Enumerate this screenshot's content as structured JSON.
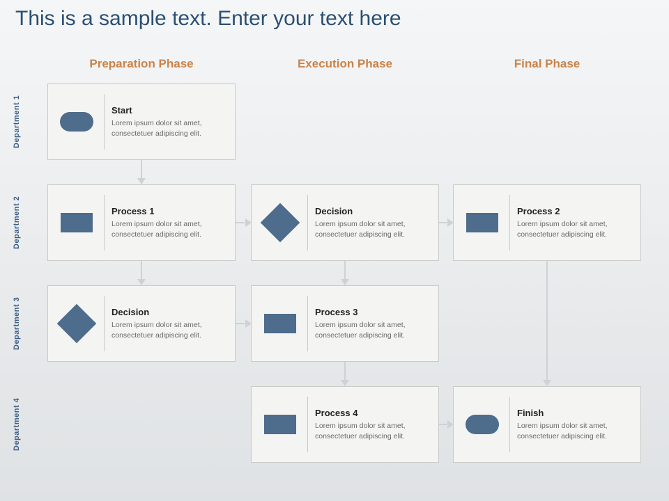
{
  "title": "This is a sample text. Enter your text here",
  "phases": {
    "p1": "Preparation Phase",
    "p2": "Execution Phase",
    "p3": "Final Phase"
  },
  "departments": {
    "d1": "Department 1",
    "d2": "Department 2",
    "d3": "Department 3",
    "d4": "Department 4"
  },
  "lorem": "Lorem ipsum dolor sit amet, consectetuer adipiscing elit.",
  "cards": {
    "start": {
      "title": "Start",
      "shape": "rounded"
    },
    "process1": {
      "title": "Process 1",
      "shape": "rect"
    },
    "decisionA": {
      "title": "Decision",
      "shape": "diamond"
    },
    "process2": {
      "title": "Process 2",
      "shape": "rect"
    },
    "decisionB": {
      "title": "Decision",
      "shape": "diamond"
    },
    "process3": {
      "title": "Process 3",
      "shape": "rect"
    },
    "process4": {
      "title": "Process 4",
      "shape": "rect"
    },
    "finish": {
      "title": "Finish",
      "shape": "rounded"
    }
  }
}
